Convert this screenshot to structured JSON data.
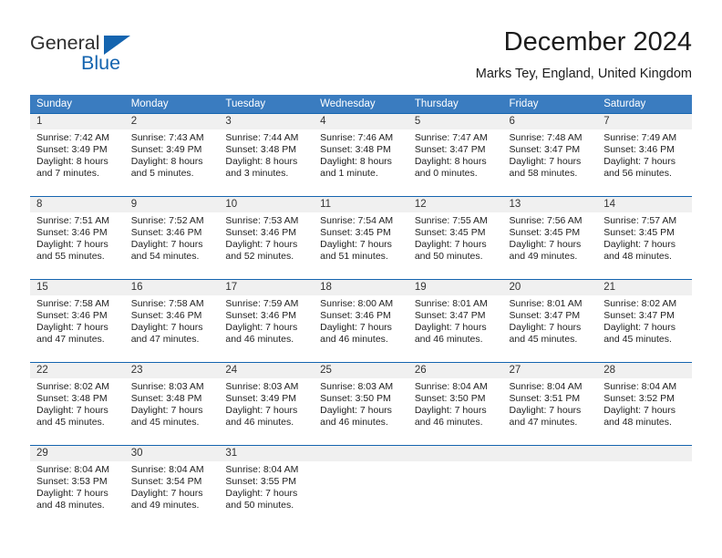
{
  "brand": {
    "name_part1": "General",
    "name_part2": "Blue",
    "triangle_color": "#1464af"
  },
  "header": {
    "title": "December 2024",
    "location": "Marks Tey, England, United Kingdom"
  },
  "theme": {
    "header_row_bg": "#3a7cc0",
    "row_border": "#1464af",
    "daynum_bg": "#f0f0f0"
  },
  "weekday_headers": [
    "Sunday",
    "Monday",
    "Tuesday",
    "Wednesday",
    "Thursday",
    "Friday",
    "Saturday"
  ],
  "weeks": [
    [
      {
        "day": "1",
        "sunrise": "Sunrise: 7:42 AM",
        "sunset": "Sunset: 3:49 PM",
        "daylight": "Daylight: 8 hours and 7 minutes."
      },
      {
        "day": "2",
        "sunrise": "Sunrise: 7:43 AM",
        "sunset": "Sunset: 3:49 PM",
        "daylight": "Daylight: 8 hours and 5 minutes."
      },
      {
        "day": "3",
        "sunrise": "Sunrise: 7:44 AM",
        "sunset": "Sunset: 3:48 PM",
        "daylight": "Daylight: 8 hours and 3 minutes."
      },
      {
        "day": "4",
        "sunrise": "Sunrise: 7:46 AM",
        "sunset": "Sunset: 3:48 PM",
        "daylight": "Daylight: 8 hours and 1 minute."
      },
      {
        "day": "5",
        "sunrise": "Sunrise: 7:47 AM",
        "sunset": "Sunset: 3:47 PM",
        "daylight": "Daylight: 8 hours and 0 minutes."
      },
      {
        "day": "6",
        "sunrise": "Sunrise: 7:48 AM",
        "sunset": "Sunset: 3:47 PM",
        "daylight": "Daylight: 7 hours and 58 minutes."
      },
      {
        "day": "7",
        "sunrise": "Sunrise: 7:49 AM",
        "sunset": "Sunset: 3:46 PM",
        "daylight": "Daylight: 7 hours and 56 minutes."
      }
    ],
    [
      {
        "day": "8",
        "sunrise": "Sunrise: 7:51 AM",
        "sunset": "Sunset: 3:46 PM",
        "daylight": "Daylight: 7 hours and 55 minutes."
      },
      {
        "day": "9",
        "sunrise": "Sunrise: 7:52 AM",
        "sunset": "Sunset: 3:46 PM",
        "daylight": "Daylight: 7 hours and 54 minutes."
      },
      {
        "day": "10",
        "sunrise": "Sunrise: 7:53 AM",
        "sunset": "Sunset: 3:46 PM",
        "daylight": "Daylight: 7 hours and 52 minutes."
      },
      {
        "day": "11",
        "sunrise": "Sunrise: 7:54 AM",
        "sunset": "Sunset: 3:45 PM",
        "daylight": "Daylight: 7 hours and 51 minutes."
      },
      {
        "day": "12",
        "sunrise": "Sunrise: 7:55 AM",
        "sunset": "Sunset: 3:45 PM",
        "daylight": "Daylight: 7 hours and 50 minutes."
      },
      {
        "day": "13",
        "sunrise": "Sunrise: 7:56 AM",
        "sunset": "Sunset: 3:45 PM",
        "daylight": "Daylight: 7 hours and 49 minutes."
      },
      {
        "day": "14",
        "sunrise": "Sunrise: 7:57 AM",
        "sunset": "Sunset: 3:45 PM",
        "daylight": "Daylight: 7 hours and 48 minutes."
      }
    ],
    [
      {
        "day": "15",
        "sunrise": "Sunrise: 7:58 AM",
        "sunset": "Sunset: 3:46 PM",
        "daylight": "Daylight: 7 hours and 47 minutes."
      },
      {
        "day": "16",
        "sunrise": "Sunrise: 7:58 AM",
        "sunset": "Sunset: 3:46 PM",
        "daylight": "Daylight: 7 hours and 47 minutes."
      },
      {
        "day": "17",
        "sunrise": "Sunrise: 7:59 AM",
        "sunset": "Sunset: 3:46 PM",
        "daylight": "Daylight: 7 hours and 46 minutes."
      },
      {
        "day": "18",
        "sunrise": "Sunrise: 8:00 AM",
        "sunset": "Sunset: 3:46 PM",
        "daylight": "Daylight: 7 hours and 46 minutes."
      },
      {
        "day": "19",
        "sunrise": "Sunrise: 8:01 AM",
        "sunset": "Sunset: 3:47 PM",
        "daylight": "Daylight: 7 hours and 46 minutes."
      },
      {
        "day": "20",
        "sunrise": "Sunrise: 8:01 AM",
        "sunset": "Sunset: 3:47 PM",
        "daylight": "Daylight: 7 hours and 45 minutes."
      },
      {
        "day": "21",
        "sunrise": "Sunrise: 8:02 AM",
        "sunset": "Sunset: 3:47 PM",
        "daylight": "Daylight: 7 hours and 45 minutes."
      }
    ],
    [
      {
        "day": "22",
        "sunrise": "Sunrise: 8:02 AM",
        "sunset": "Sunset: 3:48 PM",
        "daylight": "Daylight: 7 hours and 45 minutes."
      },
      {
        "day": "23",
        "sunrise": "Sunrise: 8:03 AM",
        "sunset": "Sunset: 3:48 PM",
        "daylight": "Daylight: 7 hours and 45 minutes."
      },
      {
        "day": "24",
        "sunrise": "Sunrise: 8:03 AM",
        "sunset": "Sunset: 3:49 PM",
        "daylight": "Daylight: 7 hours and 46 minutes."
      },
      {
        "day": "25",
        "sunrise": "Sunrise: 8:03 AM",
        "sunset": "Sunset: 3:50 PM",
        "daylight": "Daylight: 7 hours and 46 minutes."
      },
      {
        "day": "26",
        "sunrise": "Sunrise: 8:04 AM",
        "sunset": "Sunset: 3:50 PM",
        "daylight": "Daylight: 7 hours and 46 minutes."
      },
      {
        "day": "27",
        "sunrise": "Sunrise: 8:04 AM",
        "sunset": "Sunset: 3:51 PM",
        "daylight": "Daylight: 7 hours and 47 minutes."
      },
      {
        "day": "28",
        "sunrise": "Sunrise: 8:04 AM",
        "sunset": "Sunset: 3:52 PM",
        "daylight": "Daylight: 7 hours and 48 minutes."
      }
    ],
    [
      {
        "day": "29",
        "sunrise": "Sunrise: 8:04 AM",
        "sunset": "Sunset: 3:53 PM",
        "daylight": "Daylight: 7 hours and 48 minutes."
      },
      {
        "day": "30",
        "sunrise": "Sunrise: 8:04 AM",
        "sunset": "Sunset: 3:54 PM",
        "daylight": "Daylight: 7 hours and 49 minutes."
      },
      {
        "day": "31",
        "sunrise": "Sunrise: 8:04 AM",
        "sunset": "Sunset: 3:55 PM",
        "daylight": "Daylight: 7 hours and 50 minutes."
      },
      {
        "day": "",
        "sunrise": "",
        "sunset": "",
        "daylight": ""
      },
      {
        "day": "",
        "sunrise": "",
        "sunset": "",
        "daylight": ""
      },
      {
        "day": "",
        "sunrise": "",
        "sunset": "",
        "daylight": ""
      },
      {
        "day": "",
        "sunrise": "",
        "sunset": "",
        "daylight": ""
      }
    ]
  ]
}
